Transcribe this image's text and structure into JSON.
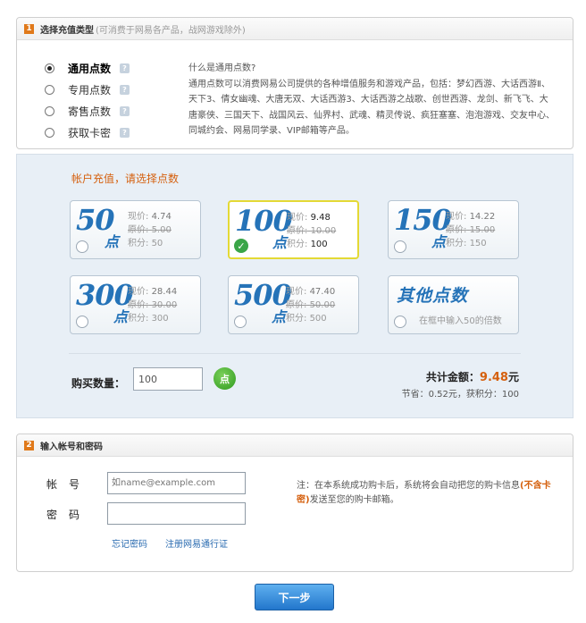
{
  "section1": {
    "num": "1",
    "title": "选择充值类型",
    "subtitle": "(可消费于网易各产品，战网游戏除外)",
    "types": [
      {
        "label": "通用点数",
        "selected": true
      },
      {
        "label": "专用点数",
        "selected": false
      },
      {
        "label": "寄售点数",
        "selected": false
      },
      {
        "label": "获取卡密",
        "selected": false
      }
    ],
    "help_icon": "?",
    "description_title": "什么是通用点数?",
    "description_body": "通用点数可以消费网易公司提供的各种增值服务和游戏产品，包括：梦幻西游、大话西游Ⅱ、天下3、倩女幽魂、大唐无双、大话西游3、大话西游之战歌、创世西游、龙剑、新飞飞、大唐豪侠、三国天下、战国风云、仙界村、武魂、精灵传说、疯狂塞塞、泡泡游戏、交友中心、同城约会、网易同学录、VIP邮箱等产品。"
  },
  "recharge": {
    "title": "帐户充值，请选择点数",
    "unit": "点",
    "cards": [
      {
        "points": "50",
        "now_label": "现价:",
        "now": "4.74",
        "orig_label": "原价:",
        "orig": "5.00",
        "score_label": "积分:",
        "score": "50",
        "selected": false
      },
      {
        "points": "100",
        "now_label": "现价:",
        "now": "9.48",
        "orig_label": "原价:",
        "orig": "10.00",
        "score_label": "积分:",
        "score": "100",
        "selected": true
      },
      {
        "points": "150",
        "now_label": "现价:",
        "now": "14.22",
        "orig_label": "原价:",
        "orig": "15.00",
        "score_label": "积分:",
        "score": "150",
        "selected": false
      },
      {
        "points": "300",
        "now_label": "现价:",
        "now": "28.44",
        "orig_label": "原价:",
        "orig": "30.00",
        "score_label": "积分:",
        "score": "300",
        "selected": false
      },
      {
        "points": "500",
        "now_label": "现价:",
        "now": "47.40",
        "orig_label": "原价:",
        "orig": "50.00",
        "score_label": "积分:",
        "score": "500",
        "selected": false
      }
    ],
    "other_title": "其他点数",
    "other_hint": "在框中输入50的倍数",
    "qty_label": "购买数量：",
    "qty_value": "100",
    "go_label": "点",
    "total_label": "共计金额：",
    "total_amount": "9.48",
    "total_unit": "元",
    "save_text": "节省：0.52元，获积分：100"
  },
  "section2": {
    "num": "2",
    "title": "输入帐号和密码",
    "account_label": "帐号",
    "account_placeholder": "如name@example.com",
    "password_label": "密码",
    "forgot_link": "忘记密码",
    "register_link": "注册网易通行证",
    "note_pre": "注：在本系统成功购卡后，系统将会自动把您的购卡信息",
    "note_hl": "(不含卡密)",
    "note_post": "发送至您的购卡邮箱。"
  },
  "next_button": "下一步",
  "colors": {
    "accent_orange": "#d5600e",
    "brand_blue": "#2573b8",
    "selected_border": "#e4d935",
    "go_green": "#3aa548"
  }
}
